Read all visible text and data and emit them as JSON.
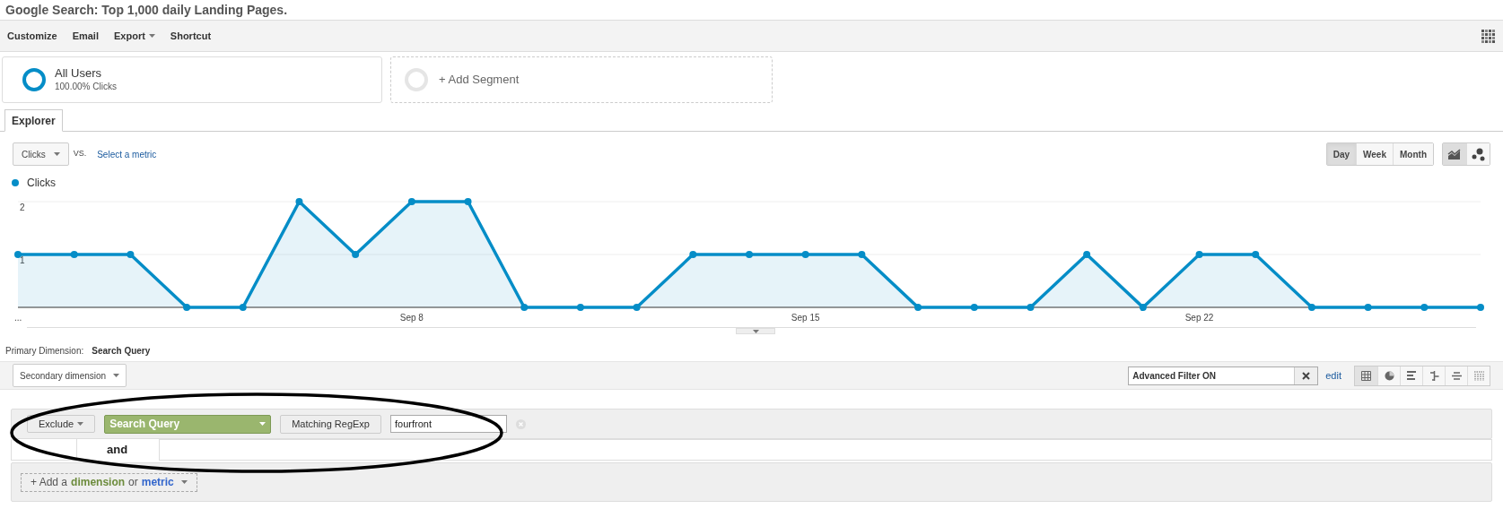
{
  "title": "Google Search: Top 1,000 daily Landing Pages.",
  "toolbar": [
    {
      "label": "Customize",
      "dropdown": false
    },
    {
      "label": "Email",
      "dropdown": false
    },
    {
      "label": "Export",
      "dropdown": true
    },
    {
      "label": "Shortcut",
      "dropdown": false
    }
  ],
  "segments": [
    {
      "kind": "segment",
      "name": "All Users",
      "detail": "100.00% Clicks"
    },
    {
      "kind": "add",
      "name": "+ Add Segment"
    }
  ],
  "tabs": [
    {
      "label": "Explorer",
      "selected": true
    }
  ],
  "metric_picker": {
    "value": "Clicks",
    "vs": "VS.",
    "link": "Select a metric"
  },
  "granularity": [
    {
      "label": "Day",
      "selected": true
    },
    {
      "label": "Week",
      "selected": false
    },
    {
      "label": "Month",
      "selected": false
    }
  ],
  "chart_types": [
    {
      "kind": "line",
      "selected": true
    },
    {
      "kind": "motion",
      "selected": false
    }
  ],
  "chart": {
    "chart_data": {
      "type": "area",
      "categories": [
        "...",
        null,
        null,
        null,
        null,
        null,
        null,
        "Sep 8",
        null,
        null,
        null,
        null,
        null,
        null,
        "Sep 15",
        null,
        null,
        null,
        null,
        null,
        null,
        "Sep 22",
        null,
        null,
        null,
        null,
        null
      ],
      "series": [
        {
          "name": "Clicks",
          "color": "#058dc7",
          "values": [
            1,
            1,
            1,
            0,
            0,
            2,
            1,
            2,
            2,
            0,
            0,
            0,
            1,
            1,
            1,
            1,
            0,
            0,
            0,
            1,
            0,
            1,
            1,
            0,
            0,
            0,
            0
          ]
        }
      ],
      "yticks": [
        1,
        2
      ],
      "ylim": [
        0,
        2
      ]
    }
  },
  "primary_dimension": {
    "label": "Primary Dimension:",
    "value": "Search Query"
  },
  "secondary_dimension": "Secondary dimension",
  "filter": {
    "value": "Advanced Filter ON",
    "edit": "edit"
  },
  "views": [
    {
      "kind": "table",
      "selected": true
    },
    {
      "kind": "pie",
      "selected": false
    },
    {
      "kind": "bar",
      "selected": false
    },
    {
      "kind": "comparison",
      "selected": false
    },
    {
      "kind": "term",
      "selected": false
    },
    {
      "kind": "pivot",
      "selected": false
    }
  ],
  "advanced_filter": {
    "mode": "Exclude",
    "dimension": "Search Query",
    "match": "Matching RegExp",
    "value": "fourfront",
    "and": "and",
    "add": [
      {
        "kind": "plain",
        "text": "+ Add a"
      },
      {
        "kind": "dimension",
        "text": "dimension"
      },
      {
        "kind": "plain",
        "text": "or"
      },
      {
        "kind": "metric",
        "text": "metric"
      }
    ]
  }
}
